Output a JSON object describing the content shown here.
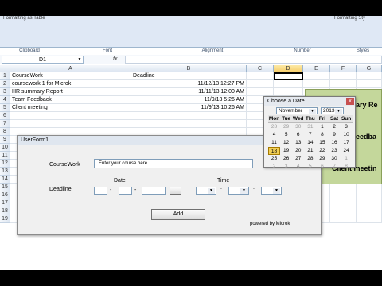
{
  "ribbon": {
    "cutoff_left": "Formatting as Table",
    "cutoff_right": "Formatting Sty",
    "groups": [
      "Clipboard",
      "Font",
      "Alignment",
      "Number",
      "Styles"
    ]
  },
  "formula_bar": {
    "name_box": "D1",
    "fx": "fx",
    "content": ""
  },
  "sheet": {
    "columns": [
      "A",
      "B",
      "C",
      "D",
      "E",
      "F",
      "G"
    ],
    "selected_column": "D",
    "rows": [
      [
        "CourseWork",
        "Deadline"
      ],
      [
        "coursework 1 for Microk",
        "11/12/13 12:27 PM"
      ],
      [
        "HR summary Report",
        "11/11/13 12:00 AM"
      ],
      [
        "Team Feedback",
        "11/9/13 5:26 AM"
      ],
      [
        "Client meeting",
        "11/9/13 10:26 AM"
      ]
    ],
    "row_numbers": [
      "1",
      "2",
      "3",
      "4",
      "5",
      "6",
      "7",
      "8",
      "9",
      "10",
      "11",
      "12",
      "13",
      "14",
      "15",
      "16",
      "17",
      "18",
      "19"
    ],
    "green_texts": [
      "ary Re",
      "eedba",
      "Client meetin"
    ]
  },
  "userform": {
    "title": "UserForm1",
    "coursework_label": "CourseWork",
    "coursework_value": "Enter your course here...",
    "deadline_label": "Deadline",
    "date_label": "Date",
    "time_label": "Time",
    "date_sep": "-",
    "time_sep": ":",
    "calendar_button": "...",
    "add_button": "Add",
    "footer": "powered by Microk"
  },
  "calendar": {
    "title": "Choose a Date",
    "close": "x",
    "month": "November",
    "year": "2013",
    "days_of_week": [
      "Mon",
      "Tue",
      "Wed",
      "Thu",
      "Fri",
      "Sat",
      "Sun"
    ],
    "weeks": [
      [
        "28",
        "29",
        "30",
        "31",
        "1",
        "2",
        "3"
      ],
      [
        "4",
        "5",
        "6",
        "7",
        "8",
        "9",
        "10"
      ],
      [
        "11",
        "12",
        "13",
        "14",
        "15",
        "16",
        "17"
      ],
      [
        "18",
        "19",
        "20",
        "21",
        "22",
        "23",
        "24"
      ],
      [
        "25",
        "26",
        "27",
        "28",
        "29",
        "30",
        "1"
      ],
      [
        "2",
        "3",
        "4",
        "5",
        "6",
        "7",
        "8"
      ]
    ],
    "selected_day": "18"
  },
  "colors": {
    "green_block": "#c4d79b",
    "selected_header": "#f7cf6e",
    "today_highlight": "#f2cf55"
  }
}
